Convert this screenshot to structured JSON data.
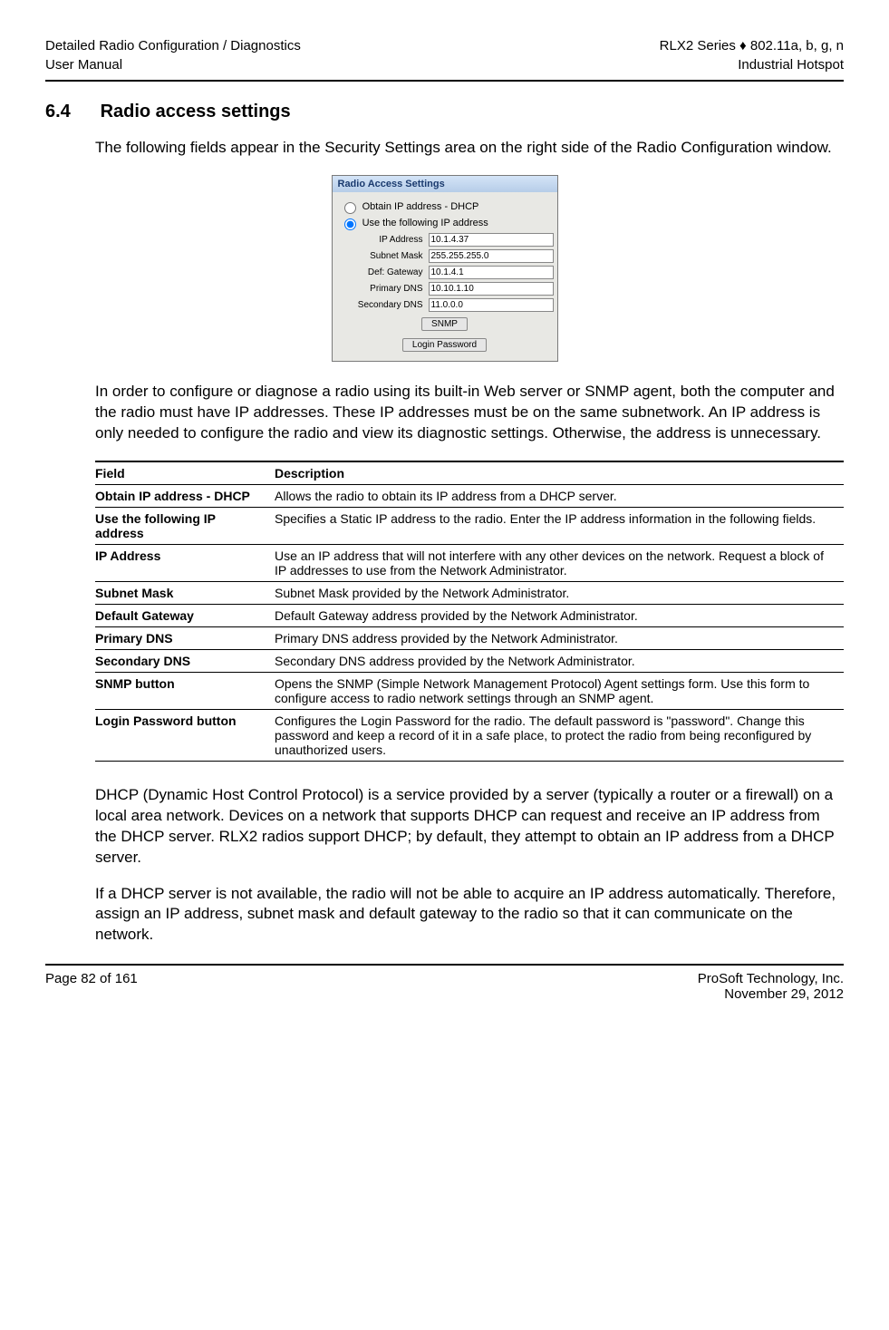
{
  "header": {
    "left1": "Detailed Radio Configuration / Diagnostics",
    "left2": "User Manual",
    "right1": "RLX2 Series ♦ 802.11a, b, g, n",
    "right2": "Industrial Hotspot"
  },
  "section": {
    "num": "6.4",
    "title": "Radio access settings"
  },
  "intro": "The following fields appear in the Security Settings area on the right side of the Radio Configuration window.",
  "panel": {
    "title": "Radio Access Settings",
    "opt_dhcp": "Obtain IP address - DHCP",
    "opt_static": "Use the following IP address",
    "ip_label": "IP Address",
    "ip_val": "10.1.4.37",
    "mask_label": "Subnet Mask",
    "mask_val": "255.255.255.0",
    "gw_label": "Def: Gateway",
    "gw_val": "10.1.4.1",
    "pdns_label": "Primary DNS",
    "pdns_val": "10.10.1.10",
    "sdns_label": "Secondary DNS",
    "sdns_val": "11.0.0.0",
    "snmp_btn": "SNMP",
    "login_btn": "Login Password"
  },
  "para2": "In order to configure or diagnose a radio using its built-in Web server or SNMP agent, both the computer and the radio must have IP addresses. These IP addresses must be on the same subnetwork.  An IP address is only needed to configure the radio and view its diagnostic settings. Otherwise, the address is unnecessary.",
  "table": {
    "h1": "Field",
    "h2": "Description",
    "rows": [
      {
        "f": "Obtain IP address - DHCP",
        "d": "Allows the radio to obtain its IP address from a DHCP server."
      },
      {
        "f": "Use the following IP address",
        "d": "Specifies a Static IP address to the radio. Enter the IP address information in the following fields."
      },
      {
        "f": "IP Address",
        "d": "Use an IP address that will not interfere with any other devices on the network. Request a block of IP addresses to use from the Network Administrator."
      },
      {
        "f": "Subnet Mask",
        "d": "Subnet Mask provided by the Network Administrator."
      },
      {
        "f": "Default Gateway",
        "d": "Default Gateway address provided by the Network Administrator."
      },
      {
        "f": "Primary DNS",
        "d": "Primary DNS address provided by the Network Administrator."
      },
      {
        "f": "Secondary DNS",
        "d": "Secondary DNS address provided by the Network Administrator."
      },
      {
        "f": "SNMP button",
        "d": "Opens the SNMP (Simple Network Management Protocol) Agent settings form. Use this form to configure access to radio network settings through an SNMP agent."
      },
      {
        "f": "Login Password button",
        "d": "Configures the Login Password for the radio. The default password is \"password\". Change this password and keep a record of it in a safe place, to protect the radio from being reconfigured by unauthorized users."
      }
    ]
  },
  "para3": "DHCP (Dynamic Host Control Protocol) is a service provided by a server (typically a router or a firewall) on a local area network. Devices on a network that supports DHCP can request and receive an IP address from the DHCP server. RLX2 radios support DHCP; by default, they attempt to obtain an IP address from a DHCP server.",
  "para4": "If a DHCP server is not available, the radio will not be able to acquire an IP address automatically.  Therefore, assign an IP address, subnet mask and default gateway to the radio so that it can communicate on the network.",
  "footer": {
    "left": "Page 82 of 161",
    "right1": "ProSoft Technology, Inc.",
    "right2": "November 29, 2012"
  }
}
